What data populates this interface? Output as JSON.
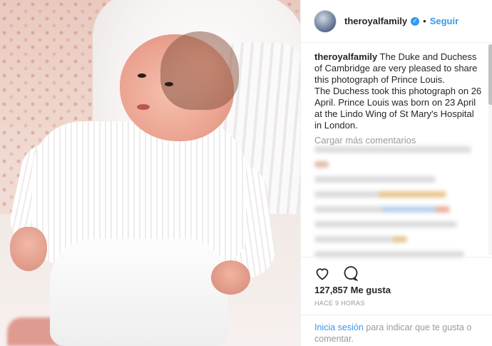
{
  "header": {
    "username": "theroyalfamily",
    "separator": "•",
    "follow_label": "Seguir"
  },
  "caption": {
    "username": "theroyalfamily",
    "text": "The Duke and Duchess of Cambridge are very pleased to share this photograph of Prince Louis.",
    "text2": "The Duchess took this photograph on 26 April. Prince Louis was born on 23 April at the Lindo Wing of St Mary's Hospital in London."
  },
  "comments": {
    "load_more_label": "Cargar más comentarios"
  },
  "post": {
    "likes": "127,857 Me gusta",
    "time": "HACE 9 HORAS"
  },
  "login": {
    "link_label": "Inicia sesión",
    "text": " para indicar que te gusta o comentar."
  },
  "icons": {
    "like": "heart-outline-icon",
    "comment": "comment-bubble-icon",
    "verified": "verified-check-icon"
  },
  "colors": {
    "accent": "#3897f0",
    "muted": "#999999",
    "text": "#262626",
    "border": "#efefef"
  }
}
